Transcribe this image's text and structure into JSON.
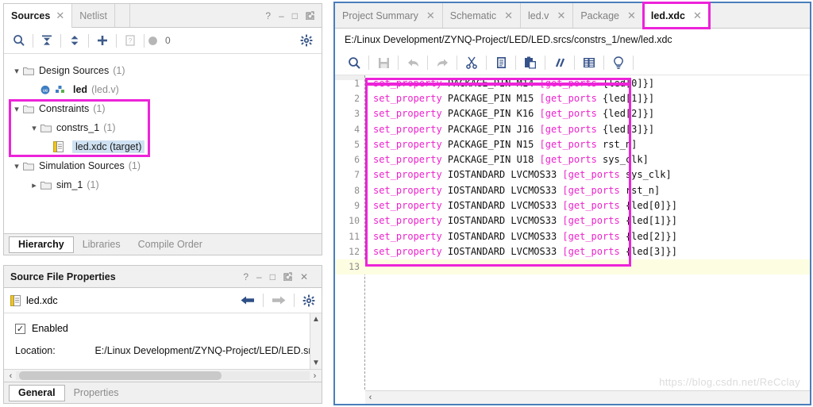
{
  "sources_panel": {
    "tabs": [
      {
        "label": "Sources",
        "active": true,
        "closable": true
      },
      {
        "label": "Netlist",
        "active": false,
        "closable": false
      }
    ],
    "window_buttons": [
      "?",
      "–",
      "□",
      "↗"
    ],
    "toolbar": [
      {
        "name": "search-icon",
        "label": "Search"
      },
      {
        "name": "collapse-all-icon",
        "label": "Collapse All"
      },
      {
        "name": "expand-all-icon",
        "label": "Expand All"
      },
      {
        "name": "add-sources-icon",
        "label": "Add Sources"
      },
      {
        "name": "report-icon",
        "label": "Report"
      },
      {
        "name": "messages-icon",
        "label": "Messages"
      }
    ],
    "message_count": "0",
    "settings_icon": "gear-icon",
    "tree": [
      {
        "indent": 0,
        "chevron": "down",
        "icon": "folder-icon",
        "label": "Design Sources",
        "count": "(1)",
        "selected": false
      },
      {
        "indent": 1,
        "chevron": "none",
        "icon": "verilog-file-icon",
        "label": "led",
        "count": "(led.v)",
        "selected": false,
        "bold": true
      },
      {
        "indent": 0,
        "chevron": "down",
        "icon": "folder-icon",
        "label": "Constraints",
        "count": "(1)",
        "selected": false
      },
      {
        "indent": 1,
        "chevron": "down",
        "icon": "folder-icon",
        "label": "constrs_1",
        "count": "(1)",
        "selected": false
      },
      {
        "indent": 2,
        "chevron": "none",
        "icon": "xdc-file-icon",
        "label": "led.xdc (target)",
        "count": "",
        "selected": true
      },
      {
        "indent": 0,
        "chevron": "down",
        "icon": "folder-icon",
        "label": "Simulation Sources",
        "count": "(1)",
        "selected": false
      },
      {
        "indent": 1,
        "chevron": "right",
        "icon": "folder-icon",
        "label": "sim_1",
        "count": "(1)",
        "selected": false
      }
    ],
    "bottom_tabs": [
      {
        "label": "Hierarchy",
        "active": true
      },
      {
        "label": "Libraries",
        "active": false
      },
      {
        "label": "Compile Order",
        "active": false
      }
    ]
  },
  "properties_panel": {
    "title": "Source File Properties",
    "window_buttons": [
      "?",
      "–",
      "□",
      "↗",
      "✕"
    ],
    "file_icon": "xdc-file-icon",
    "file_name": "led.xdc",
    "nav_back_icon": "arrow-left-icon",
    "nav_forward_icon": "arrow-right-icon",
    "settings_icon": "gear-icon",
    "enabled_checkbox": {
      "label": "Enabled",
      "checked": true,
      "mark": "✓"
    },
    "location_label": "Location:",
    "location_value": "E:/Linux Development/ZYNQ-Project/LED/LED.srcs",
    "bottom_tabs": [
      {
        "label": "General",
        "active": true
      },
      {
        "label": "Properties",
        "active": false
      }
    ]
  },
  "editor_panel": {
    "tabs": [
      {
        "label": "Project Summary",
        "active": false,
        "highlighted": false
      },
      {
        "label": "Schematic",
        "active": false,
        "highlighted": false
      },
      {
        "label": "led.v",
        "active": false,
        "highlighted": false
      },
      {
        "label": "Package",
        "active": false,
        "highlighted": false
      },
      {
        "label": "led.xdc",
        "active": true,
        "highlighted": true
      }
    ],
    "close_glyph": "✕",
    "file_path": "E:/Linux Development/ZYNQ-Project/LED/LED.srcs/constrs_1/new/led.xdc",
    "toolbar": [
      {
        "name": "search-icon",
        "enabled": true
      },
      {
        "name": "save-icon",
        "enabled": false
      },
      {
        "name": "undo-icon",
        "enabled": false
      },
      {
        "name": "redo-icon",
        "enabled": false
      },
      {
        "name": "cut-icon",
        "enabled": true
      },
      {
        "name": "copy-icon",
        "enabled": true
      },
      {
        "name": "paste-icon",
        "enabled": true
      },
      {
        "name": "comment-icon",
        "enabled": true
      },
      {
        "name": "indent-icon",
        "enabled": true
      },
      {
        "name": "hint-icon",
        "enabled": true
      }
    ],
    "current_line": 13,
    "code_lines": [
      {
        "num": "1",
        "kw": "set_property",
        "mid": " PACKAGE_PIN M14 ",
        "arg_open": "[",
        "fn": "get_ports",
        "tail": " {led[0]}]"
      },
      {
        "num": "2",
        "kw": "set_property",
        "mid": " PACKAGE_PIN M15 ",
        "arg_open": "[",
        "fn": "get_ports",
        "tail": " {led[1]}]"
      },
      {
        "num": "3",
        "kw": "set_property",
        "mid": " PACKAGE_PIN K16 ",
        "arg_open": "[",
        "fn": "get_ports",
        "tail": " {led[2]}]"
      },
      {
        "num": "4",
        "kw": "set_property",
        "mid": " PACKAGE_PIN J16 ",
        "arg_open": "[",
        "fn": "get_ports",
        "tail": " {led[3]}]"
      },
      {
        "num": "5",
        "kw": "set_property",
        "mid": " PACKAGE_PIN N15 ",
        "arg_open": "[",
        "fn": "get_ports",
        "tail": " rst_n]"
      },
      {
        "num": "6",
        "kw": "set_property",
        "mid": " PACKAGE_PIN U18 ",
        "arg_open": "[",
        "fn": "get_ports",
        "tail": " sys_clk]"
      },
      {
        "num": "7",
        "kw": "set_property",
        "mid": " IOSTANDARD LVCMOS33 ",
        "arg_open": "[",
        "fn": "get_ports",
        "tail": " sys_clk]"
      },
      {
        "num": "8",
        "kw": "set_property",
        "mid": " IOSTANDARD LVCMOS33 ",
        "arg_open": "[",
        "fn": "get_ports",
        "tail": " rst_n]"
      },
      {
        "num": "9",
        "kw": "set_property",
        "mid": " IOSTANDARD LVCMOS33 ",
        "arg_open": "[",
        "fn": "get_ports",
        "tail": " {led[0]}]"
      },
      {
        "num": "10",
        "kw": "set_property",
        "mid": " IOSTANDARD LVCMOS33 ",
        "arg_open": "[",
        "fn": "get_ports",
        "tail": " {led[1]}]"
      },
      {
        "num": "11",
        "kw": "set_property",
        "mid": " IOSTANDARD LVCMOS33 ",
        "arg_open": "[",
        "fn": "get_ports",
        "tail": " {led[2]}]"
      },
      {
        "num": "12",
        "kw": "set_property",
        "mid": " IOSTANDARD LVCMOS33 ",
        "arg_open": "[",
        "fn": "get_ports",
        "tail": " {led[3]}]"
      },
      {
        "num": "13",
        "kw": "",
        "mid": "",
        "arg_open": "",
        "fn": "",
        "tail": ""
      }
    ],
    "scroll_left_arrow": "‹"
  },
  "annotations": {
    "highlight_color": "#ed23d9",
    "boxes": [
      "constraints-tree-box",
      "editor-tab-box",
      "code-block-box",
      "toolbar-underline"
    ]
  },
  "watermark": "https://blog.csdn.net/ReCclay",
  "colors": {
    "keyword": "#ee22cc",
    "plain": "#111111",
    "selection": "#cfe2f3",
    "current_line": "#fdfde2",
    "panel_border": "#4a7ebb"
  }
}
